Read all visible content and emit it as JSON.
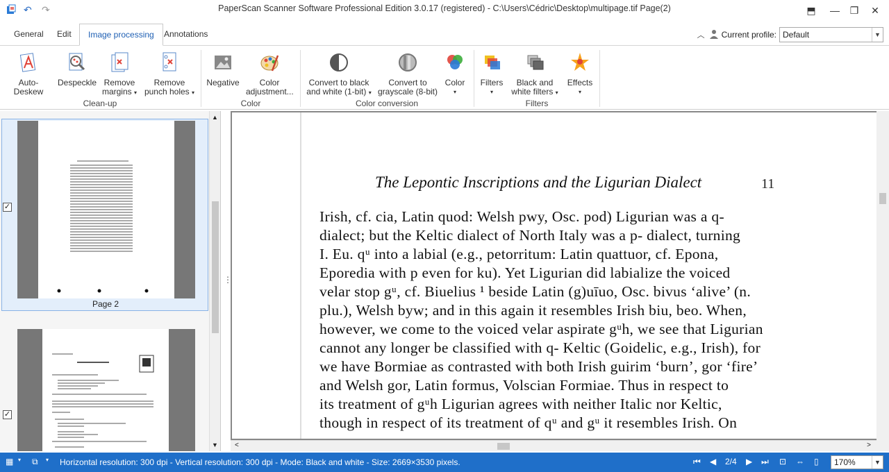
{
  "window": {
    "title": "PaperScan Scanner Software Professional Edition 3.0.17 (registered) - C:\\Users\\Cédric\\Desktop\\multipage.tif Page(2)"
  },
  "tabs": [
    {
      "label": "General"
    },
    {
      "label": "Edit"
    },
    {
      "label": "Image processing"
    },
    {
      "label": "Annotations"
    }
  ],
  "profile": {
    "label": "Current profile:",
    "value": "Default"
  },
  "ribbon": {
    "cleanup": {
      "label": "Clean-up",
      "auto_deskew": "Auto-Deskew",
      "despeckle": "Despeckle",
      "remove_margins_1": "Remove",
      "remove_margins_2": "margins",
      "remove_punch_1": "Remove",
      "remove_punch_2": "punch holes"
    },
    "color": {
      "label": "Color",
      "negative": "Negative",
      "color_adj_1": "Color",
      "color_adj_2": "adjustment..."
    },
    "conversion": {
      "label": "Color conversion",
      "bw_1": "Convert to black",
      "bw_2": "and white (1-bit)",
      "gray_1": "Convert to",
      "gray_2": "grayscale (8-bit)",
      "color": "Color"
    },
    "filters": {
      "label": "Filters",
      "filters": "Filters",
      "bwf_1": "Black and",
      "bwf_2": "white filters",
      "effects": "Effects"
    }
  },
  "thumbnails": [
    {
      "label": "Page 2",
      "checked": true,
      "selected": true
    },
    {
      "label": "",
      "checked": true,
      "selected": false
    }
  ],
  "document": {
    "header": "The Lepontic Inscriptions and the Ligurian Dialect",
    "page_number": "11",
    "lines": [
      "Irish, cf. cia, Latin quod: Welsh pwy, Osc. pod) Ligurian was a q-",
      "dialect; but the Keltic dialect of North Italy was a p- dialect, turning",
      "I. Eu. qᵘ into a labial (e.g., petorritum: Latin quattuor, cf. Epona,",
      "Eporedia with p even for ku). Yet Ligurian did labialize the voiced",
      "velar stop gᵘ, cf. Biuelius ¹ beside Latin (g)uīuo, Osc. bivus ‘alive’ (n.",
      "plu.), Welsh byw; and in this again it resembles Irish biu, beo. When,",
      "however, we come to the voiced velar aspirate gᵘh, we see that Ligurian",
      "cannot any longer be classified with q- Keltic (Goidelic, e.g., Irish), for",
      "we have Bormiae as contrasted with both Irish guirim ‘burn’, gor ‘fire’",
      "and Welsh gor, Latin formus, Volscian Formiae. Thus in respect to",
      "its treatment of gᵘh Ligurian agrees with neither Italic nor Keltic,",
      "though in respect of its treatment of qᵘ and gᵘ it resembles Irish. On"
    ]
  },
  "status": {
    "info": "Horizontal resolution: 300 dpi - Vertical resolution: 300 dpi - Mode: Black and white - Size: 2669×3530 pixels.",
    "page": "2/4",
    "zoom": "170%"
  }
}
